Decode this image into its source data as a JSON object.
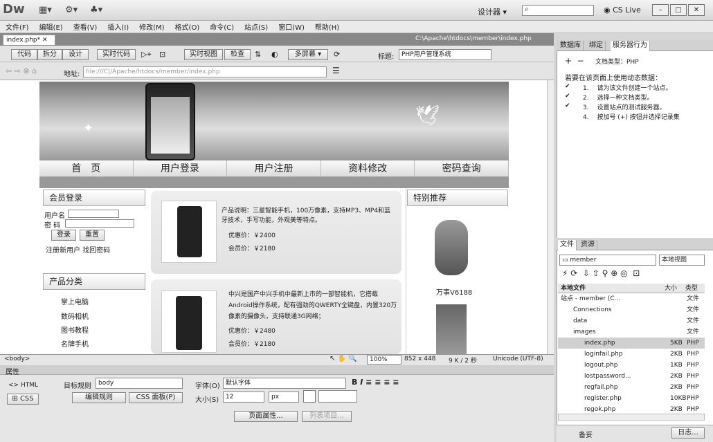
{
  "app": {
    "logo": "Dw",
    "workspace": "设计器",
    "cslive": "CS Live"
  },
  "menu": [
    "文件(F)",
    "编辑(E)",
    "查看(V)",
    "插入(I)",
    "修改(M)",
    "格式(O)",
    "命令(C)",
    "站点(S)",
    "窗口(W)",
    "帮助(H)"
  ],
  "document": {
    "tab": "index.php*",
    "path": "C:\\Apache\\htdocs\\member\\index.php"
  },
  "toolbar": {
    "code": "代码",
    "split": "拆分",
    "design": "设计",
    "live_code": "实时代码",
    "live_view": "实时视图",
    "inspect": "检查",
    "multiscreen": "多屏幕",
    "title_label": "标题:",
    "title_value": "PHP用户管理系统"
  },
  "address": {
    "label": "地址:",
    "value": "file:///C|/Apache/htdocs/member/index.php"
  },
  "page": {
    "nav": [
      "首　页",
      "用户登录",
      "用户注册",
      "资料修改",
      "密码查询"
    ],
    "login": {
      "title": "会员登录",
      "user_label": "用户名",
      "pwd_label": "密 码",
      "login_btn": "登录",
      "reset_btn": "重置",
      "links": "注册新用户 找回密码"
    },
    "category": {
      "title": "产品分类",
      "items": [
        "掌上电脑",
        "数码相机",
        "图书教程",
        "名牌手机"
      ]
    },
    "products": [
      {
        "desc": "产品说明：三星智能手机，100万像素，支持MP3、MP4和蓝牙技术，手写功能，外观美等特点。",
        "price1": "优惠价：￥2400",
        "price2": "会员价：￥2180"
      },
      {
        "desc": "中兴是国产中兴手机中最新上市的一部智能机，它搭载Android操作系统，配有强劲的QWERTY全键盘，内置320万像素的摄像头，支持联通3G网络；",
        "price1": "优惠价：￥2480",
        "price2": "会员价：￥2180"
      }
    ],
    "special": {
      "title": "特别推荐",
      "item1": "万事V6188"
    }
  },
  "status": {
    "tag": "<body>",
    "zoom": "100%",
    "size": "852 x 448",
    "weight": "9 K / 2 秒",
    "encoding": "Unicode (UTF-8)"
  },
  "properties": {
    "title": "属性",
    "html": "HTML",
    "css": "CSS",
    "target_rule_label": "目标规则",
    "target_rule": "body",
    "edit_rule": "编辑规则",
    "css_panel": "CSS 面板(P)",
    "font_label": "字体(O)",
    "font_value": "默认字体",
    "size_label": "大小(S)",
    "size_value": "12",
    "unit": "px",
    "page_props": "页面属性...",
    "list_item": "列表项目..."
  },
  "server_panel": {
    "tabs": [
      "数据库",
      "绑定",
      "服务器行为"
    ],
    "doc_type": "文档类型：PHP",
    "intro": "若要在该页面上使用动态数据：",
    "steps": [
      "1.　 请为该文件创建一个站点。",
      "2.　 选择一种文档类型。",
      "3.　 设置站点的测试服务器。",
      "4.　 按加号 (+) 按钮并选择记录集"
    ]
  },
  "files_panel": {
    "tabs": [
      "文件",
      "资源"
    ],
    "site": "member",
    "view": "本地视图",
    "col_local": "本地文件",
    "col_size": "大小",
    "col_type": "类型",
    "rows": [
      {
        "name": "站点 - member (C...",
        "size": "",
        "type": "文件"
      },
      {
        "name": "Connections",
        "size": "",
        "type": "文件"
      },
      {
        "name": "data",
        "size": "",
        "type": "文件"
      },
      {
        "name": "images",
        "size": "",
        "type": "文件"
      },
      {
        "name": "index.php",
        "size": "5KB",
        "type": "PHP"
      },
      {
        "name": "loginfail.php",
        "size": "2KB",
        "type": "PHP"
      },
      {
        "name": "logout.php",
        "size": "1KB",
        "type": "PHP"
      },
      {
        "name": "lostpassword...",
        "size": "2KB",
        "type": "PHP"
      },
      {
        "name": "regfail.php",
        "size": "2KB",
        "type": "PHP"
      },
      {
        "name": "register.php",
        "size": "10KB",
        "type": "PHP"
      },
      {
        "name": "regok.php",
        "size": "2KB",
        "type": "PHP"
      }
    ],
    "footer_left": "备妥",
    "footer_right": "日志..."
  }
}
